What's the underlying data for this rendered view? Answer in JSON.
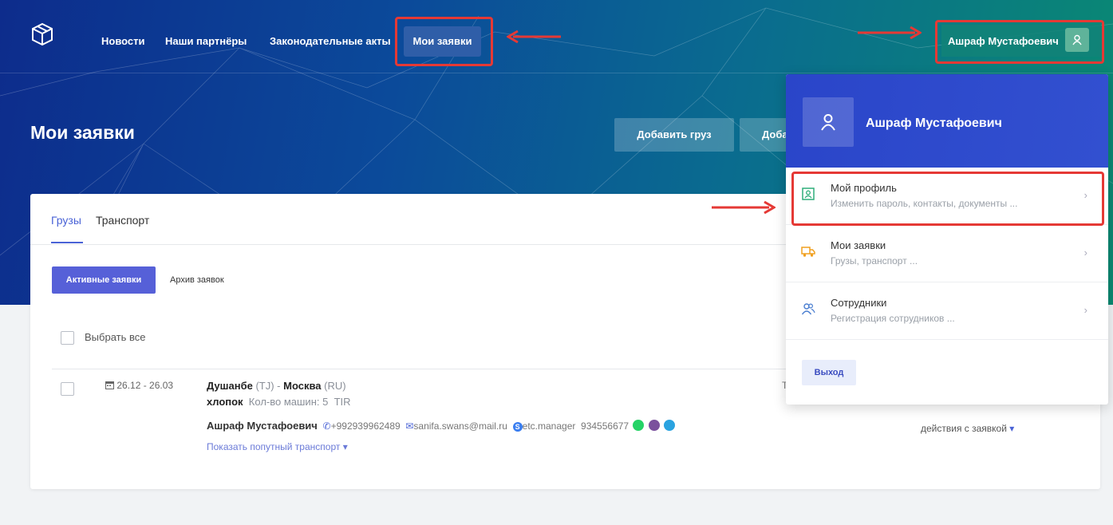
{
  "nav": {
    "links": [
      "Новости",
      "Наши партнёры",
      "Законодательные акты"
    ],
    "active": "Мои заявки",
    "user_name": "Ашраф Мустафоевич",
    "avatar_glyph": "ጰ"
  },
  "page": {
    "title": "Мои заявки",
    "add_cargo": "Добавить груз",
    "add_transport_partial": "Доба"
  },
  "tabs": [
    "Грузы",
    "Транспорт"
  ],
  "filters": {
    "active": "Активные заявки",
    "archive": "Архив заявок"
  },
  "select_all": "Выбрать все",
  "request": {
    "date": "26.12 - 26.03",
    "from_city": "Душанбе",
    "from_code": "(TJ)",
    "sep": " - ",
    "to_city": "Москва",
    "to_code": "(RU)",
    "cargo": "хлопок",
    "cars": "Кол-во машин: 5",
    "type": "TIR",
    "contact_name": "Ашраф Мустафоевич",
    "phone": "+992939962489",
    "email": "sanifa.swans@mail.ru",
    "skype": "etc.manager",
    "extra_phone": "934556677",
    "show_transport": "Показать попутный транспорт",
    "actions": "действия с заявкой",
    "truncated_letter": "Т"
  },
  "dropdown": {
    "name": "Ашраф Мустафоевич",
    "items": [
      {
        "title": "Мой профиль",
        "subtitle": "Изменить пароль, контакты, документы ..."
      },
      {
        "title": "Мои заявки",
        "subtitle": "Грузы, транспорт ..."
      },
      {
        "title": "Сотрудники",
        "subtitle": "Регистрация сотрудников ..."
      }
    ],
    "exit": "Выход"
  },
  "colors": {
    "accent": "#5660d8",
    "highlight": "#e53935"
  }
}
